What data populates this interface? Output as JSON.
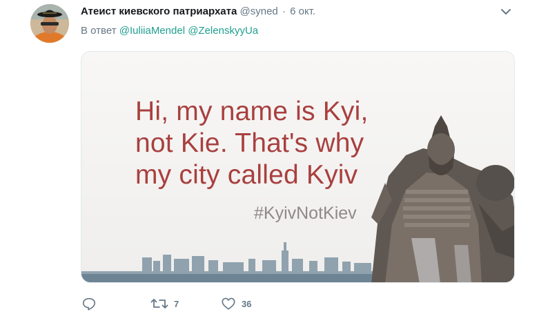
{
  "tweet": {
    "author_name": "Атеист киевского патриархата",
    "author_handle": "@syned",
    "separator": "·",
    "time": "6 окт.",
    "reply_prefix": "В ответ",
    "mentions": [
      "@IuliiaMendel",
      "@ZelenskyyUa"
    ]
  },
  "media": {
    "lines": [
      "Hi, my name is Kyi,",
      "not Kie. That's why",
      "my city called Kyiv"
    ],
    "hashtag": "#KyivNotKiev"
  },
  "actions": {
    "reply_count": "",
    "retweet_count": "7",
    "like_count": "36"
  },
  "icons": {
    "avatar": "user-avatar",
    "more": "chevron-down-icon",
    "reply": "reply-icon",
    "retweet": "retweet-icon",
    "like": "heart-icon"
  },
  "colors": {
    "link": "#1f9f8f",
    "muted": "#657786",
    "image_text": "#a8403f"
  }
}
